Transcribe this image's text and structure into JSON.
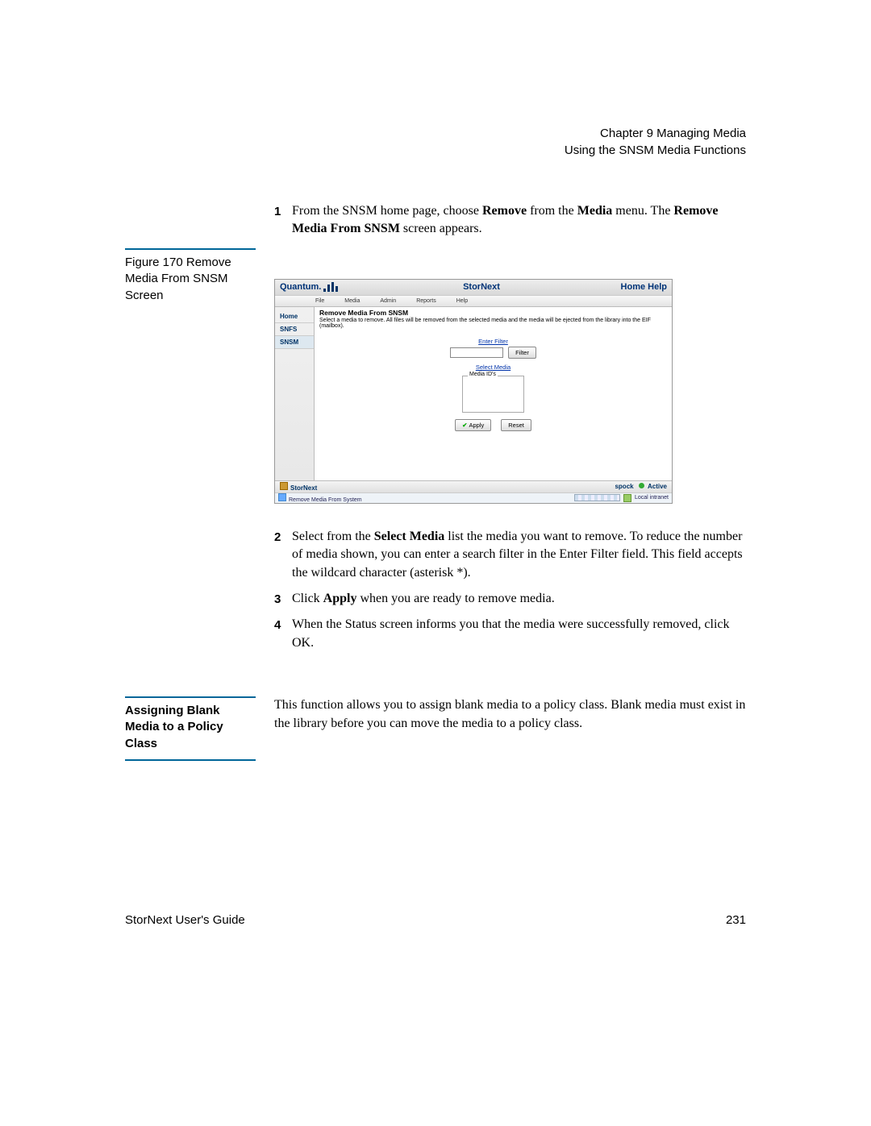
{
  "header": {
    "chapter": "Chapter 9  Managing Media",
    "section": "Using the SNSM Media Functions"
  },
  "steps_a": [
    {
      "num": "1",
      "text_pre": "From the SNSM home page, choose ",
      "text_b1": "Remove",
      "text_mid1": " from the ",
      "text_b2": "Media",
      "text_mid2": " menu. The ",
      "text_b3": "Remove Media From SNSM",
      "text_post": " screen appears."
    }
  ],
  "figure_caption": "Figure 170  Remove Media From SNSM Screen",
  "screenshot": {
    "brand": "Quantum.",
    "app_title": "StorNext",
    "header_links": "Home  Help",
    "menu": [
      "File",
      "Media",
      "Admin",
      "Reports",
      "Help"
    ],
    "sidebar": [
      "Home",
      "SNFS",
      "SNSM"
    ],
    "panel_title": "Remove Media From SNSM",
    "panel_desc": "Select a media to remove. All files will be removed from the selected media and the media will be ejected from the library into the EIF (mailbox).",
    "enter_filter_label": "Enter Filter",
    "filter_btn": "Filter",
    "select_media_label": "Select Media",
    "media_ids_legend": "Media ID's",
    "apply_btn": "Apply",
    "reset_btn": "Reset",
    "bottom_brand": "StorNext",
    "host": "spock",
    "status": "Active",
    "statusbar_left": "Remove Media From System",
    "statusbar_right": "Local intranet"
  },
  "steps_b": {
    "s2": {
      "num": "2",
      "pre": "Select from the ",
      "b1": "Select Media",
      "post": " list the media you want to remove. To reduce the number of media shown, you can enter a search filter in the Enter Filter field. This field accepts the wildcard character (asterisk *)."
    },
    "s3": {
      "num": "3",
      "pre": "Click ",
      "b1": "Apply",
      "post": " when you are ready to remove media."
    },
    "s4": {
      "num": "4",
      "text": "When the Status screen informs you that the media were successfully removed, click OK."
    }
  },
  "section2": {
    "heading": "Assigning Blank Media to a Policy Class",
    "body": "This function allows you to assign blank media to a policy class. Blank media must exist in the library before you can move the media to a policy class."
  },
  "footer": {
    "left": "StorNext User's Guide",
    "right": "231"
  }
}
